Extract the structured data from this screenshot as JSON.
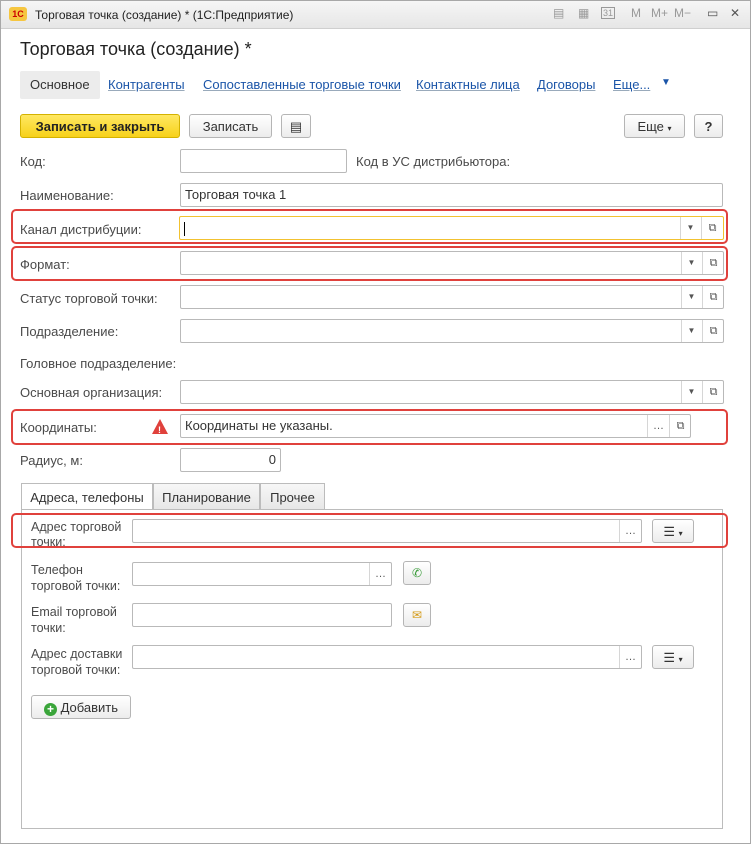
{
  "window": {
    "title": "Торговая точка (создание) * (1С:Предприятие)",
    "logo": "1С"
  },
  "titlebar_icons": {
    "m": "M",
    "m_plus": "M+",
    "m_minus": "M−",
    "calendar_day": "31"
  },
  "form": {
    "heading": "Торговая точка (создание) *"
  },
  "nav_tabs": [
    "Основное",
    "Контрагенты",
    "Сопоставленные торговые точки",
    "Контактные лица",
    "Договоры",
    "Еще..."
  ],
  "toolbar": {
    "save_close": "Записать и закрыть",
    "save": "Записать",
    "more": "Еще",
    "help": "?"
  },
  "fields": {
    "kod": {
      "label": "Код:",
      "value": ""
    },
    "kod_us": {
      "label": "Код в УС дистрибьютора:"
    },
    "name": {
      "label": "Наименование:",
      "value": "Торговая точка 1"
    },
    "channel": {
      "label": "Канал дистрибуции:",
      "value": ""
    },
    "format": {
      "label": "Формат:",
      "value": ""
    },
    "status": {
      "label": "Статус торговой точки:",
      "value": ""
    },
    "division": {
      "label": "Подразделение:",
      "value": ""
    },
    "head_division": {
      "label": "Головное подразделение:"
    },
    "org": {
      "label": "Основная организация:",
      "value": ""
    },
    "coords": {
      "label": "Координаты:",
      "value": "Координаты не указаны."
    },
    "radius": {
      "label": "Радиус, м:",
      "value": "0"
    }
  },
  "sub_tabs": [
    "Адреса, телефоны",
    "Планирование",
    "Прочее"
  ],
  "contacts": {
    "address_label": "Адрес торговой точки:",
    "phone_label": "Телефон торговой точки:",
    "email_label": "Email торговой точки:",
    "delivery_label": "Адрес доставки торговой точки:",
    "add_button": "Добавить"
  },
  "colors": {
    "accent": "#f7d11a",
    "highlight": "#e0413c",
    "link": "#1b55a8"
  }
}
